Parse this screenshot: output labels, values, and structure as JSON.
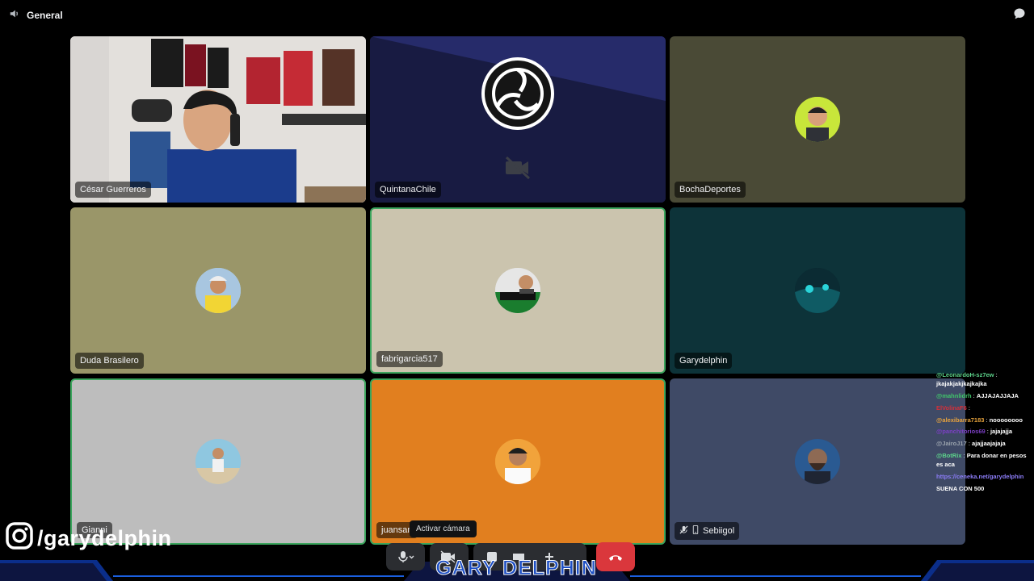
{
  "header": {
    "channel_name": "General"
  },
  "tiles": [
    {
      "name": "César Guerreros"
    },
    {
      "name": "QuintanaChile"
    },
    {
      "name": "BochaDeportes"
    },
    {
      "name": "Duda Brasilero"
    },
    {
      "name": "fabrigarcia517"
    },
    {
      "name": "Garydelphin"
    },
    {
      "name": "Gianni"
    },
    {
      "name": "juansan"
    },
    {
      "name": "Sebiigol"
    }
  ],
  "tooltip": {
    "text": "Activar cámara"
  },
  "overlay": {
    "instagram_handle": "/garydelphin",
    "brand": "GARY DELPHIN"
  },
  "chat": [
    {
      "user": "@LeonardoH-sz7ew",
      "sep": " : ",
      "text": "jkajakjakjkajkajka",
      "color": "#5dd48b"
    },
    {
      "user": "@mahnlidrh",
      "sep": " : ",
      "text": "AJJAJAJJAJA",
      "color": "#40c66a"
    },
    {
      "user": "ElVolinaF6",
      "sep": " : ",
      "text": "",
      "color": "#d4303a"
    },
    {
      "user": "@alexibarra7183",
      "sep": " : ",
      "text": "noooooooo",
      "color": "#e8a33c"
    },
    {
      "user": "@panchitorios69",
      "sep": " : ",
      "text": "jajajajja",
      "color": "#7b3fc4"
    },
    {
      "user": "@JairoJ17",
      "sep": " : ",
      "text": "ajajjaajajaja",
      "color": "#9aa3ad"
    },
    {
      "user": "@BotRix",
      "sep": " : ",
      "text": "Para donar en pesos es aca",
      "color": "#5dd48b"
    },
    {
      "user": "https://ceneka.net/garydelphin",
      "sep": "",
      "text": "",
      "color": "#8b7cf6"
    },
    {
      "user": "",
      "sep": "",
      "text": "SUENA CON 500",
      "color": "#ffffff"
    }
  ],
  "colors": {
    "speaking_border": "#3ba55d",
    "end_call": "#da373c",
    "brand_blue": "#1d4fc4"
  }
}
